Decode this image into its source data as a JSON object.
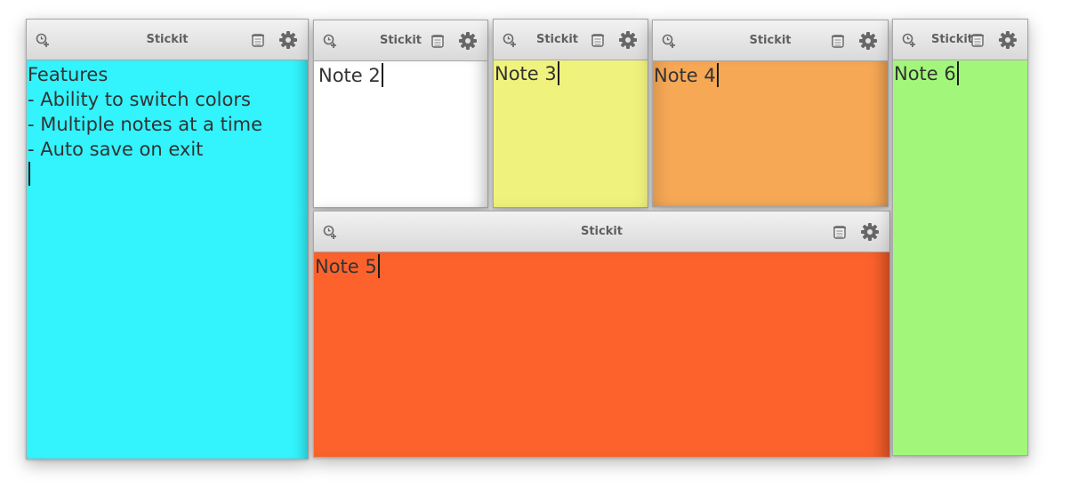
{
  "app_title": "Stickit",
  "icons": {
    "new": "new-note-icon",
    "trash": "trash-icon",
    "settings": "gear-icon"
  },
  "notes": [
    {
      "title": "Stickit",
      "color": "#33f3fc",
      "lines": [
        "Features",
        "- Ability to switch colors",
        "- Multiple notes at a time",
        "- Auto save on exit"
      ]
    },
    {
      "title": "Stickit",
      "color": "#ffffff",
      "lines": [
        "Note 2"
      ]
    },
    {
      "title": "Stickit",
      "color": "#f0f27e",
      "lines": [
        "Note 3"
      ]
    },
    {
      "title": "Stickit",
      "color": "#f6a855",
      "lines": [
        "Note 4"
      ]
    },
    {
      "title": "Stickit",
      "color": "#fd622c",
      "lines": [
        "Note 5"
      ]
    },
    {
      "title": "Stickit",
      "color": "#a2f77b",
      "lines": [
        "Note 6"
      ]
    }
  ]
}
